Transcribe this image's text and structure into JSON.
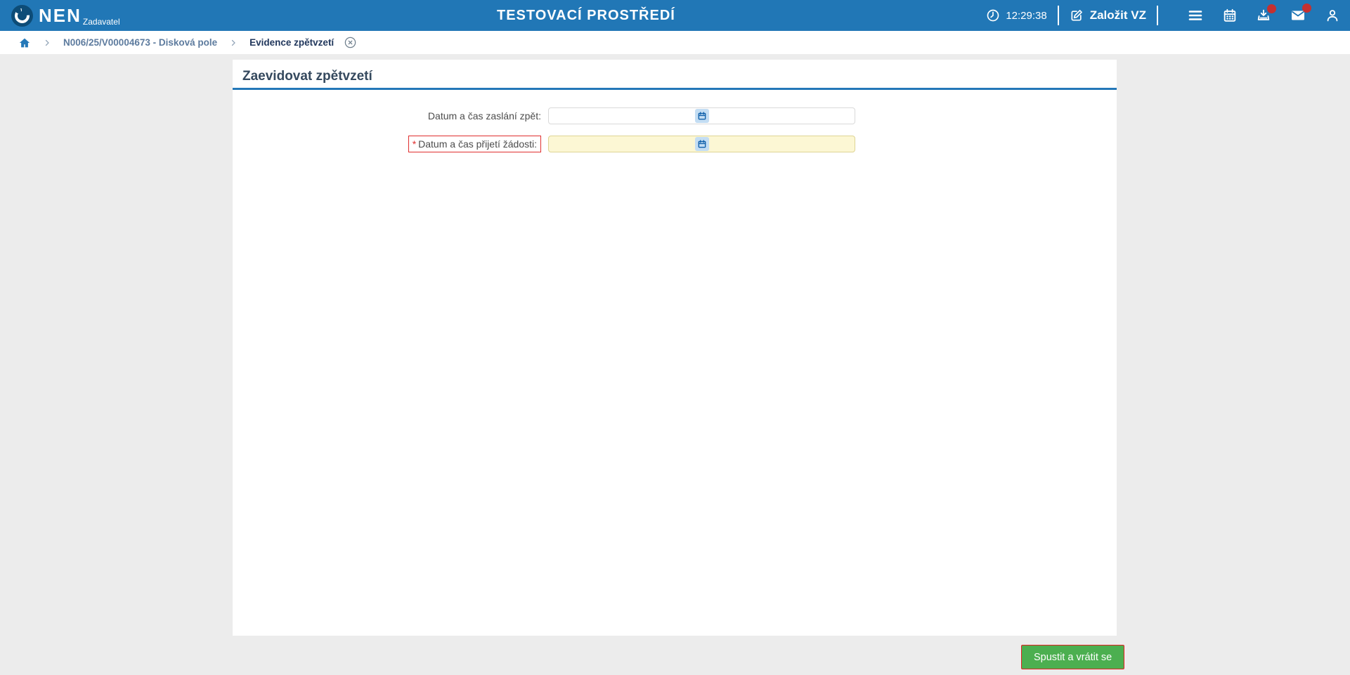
{
  "topbar": {
    "brand": "NEN",
    "brand_sub": "Zadavatel",
    "environment_title": "TESTOVACÍ PROSTŘEDÍ",
    "clock_time": "12:29:38",
    "create_vz_label": "Založit VZ",
    "notifications": {
      "downloads_badge": true,
      "mail_badge": true
    }
  },
  "breadcrumb": {
    "items": [
      {
        "label": "N006/25/V00004673 - Disková pole",
        "active": false
      },
      {
        "label": "Evidence zpětvzetí",
        "active": true,
        "closable": true
      }
    ]
  },
  "page": {
    "heading": "Zaevidovat zpětvzetí",
    "fields": [
      {
        "label": "Datum a čas zaslání zpět:",
        "value": "",
        "required": false
      },
      {
        "label": "Datum a čas přijetí žádosti:",
        "value": "",
        "required": true,
        "required_marker": "*"
      }
    ],
    "submit_label": "Spustit a vrátit se"
  },
  "colors": {
    "topbar_blue": "#2177b6",
    "accent_blue": "#2478b8",
    "logo_navy": "#0d4c77",
    "breadcrumb_link": "#5d7b9e",
    "breadcrumb_active": "#21375c",
    "required_red": "#e02e2e",
    "required_field_yellow": "#fcf7d4",
    "calendar_button_blue": "#c3ddf3",
    "submit_green": "#4caf50",
    "badge_red": "#c53030"
  }
}
